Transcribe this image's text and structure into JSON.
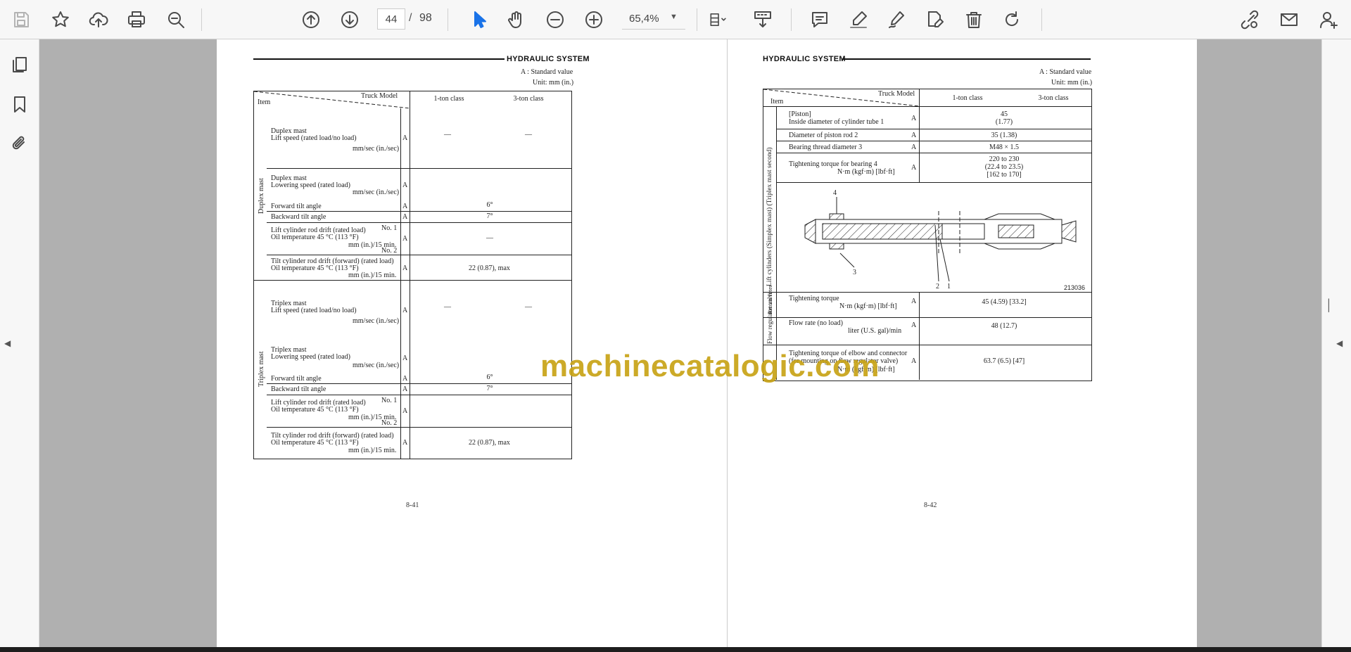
{
  "toolbar": {
    "page_current": "44",
    "page_separator": "/",
    "page_total": "98",
    "zoom": "65,4%",
    "icons": [
      "save-icon",
      "bookmark-star-icon",
      "upload-cloud-icon",
      "print-icon",
      "zoom-out-search-icon",
      "previous-page-icon",
      "next-page-icon",
      "select-arrow-icon",
      "hand-tool-icon",
      "zoom-out-icon",
      "zoom-in-icon",
      "page-view-icon",
      "scroll-mode-icon",
      "comment-icon",
      "highlight-pen-icon",
      "draw-pen-icon",
      "fill-sign-icon",
      "delete-icon",
      "rotate-icon",
      "share-link-icon",
      "email-icon",
      "add-user-icon"
    ]
  },
  "sidebar": {
    "icons": [
      "thumbnails-icon",
      "bookmarks-icon",
      "attachments-icon"
    ]
  },
  "watermark": "machinecatalogic.com",
  "left_page": {
    "header": "HYDRAULIC SYSTEM",
    "standard_note": "A : Standard value",
    "unit_note": "Unit: mm (in.)",
    "col_truck_model": "Truck Model",
    "col_item": "Item",
    "col_1ton": "1-ton class",
    "col_3ton": "3-ton class",
    "group_duplex": "Duplex mast",
    "group_triplex": "Triplex mast",
    "rows": {
      "dup_lift_1": "Duplex mast",
      "dup_lift_2": "Lift speed (rated load/no load)",
      "dup_lift_3": "mm/sec (in./sec)",
      "dup_lower_1": "Duplex mast",
      "dup_lower_2": "Lowering speed (rated load)",
      "dup_lower_3": "mm/sec (in./sec)",
      "dup_fwd": "Forward tilt angle",
      "dup_fwd_val": "6°",
      "dup_bwd": "Backward tilt angle",
      "dup_bwd_val": "7°",
      "dup_drift_1": "Lift cylinder rod drift (rated load)",
      "dup_drift_no1": "No. 1",
      "dup_drift_2": "Oil temperature 45 °C (113 °F)",
      "dup_drift_3": "mm (in.)/15 min.",
      "dup_drift_no2": "No. 2",
      "dup_drift_val": "—",
      "dup_tilt_1": "Tilt cylinder rod drift (forward) (rated load)",
      "dup_tilt_2": "Oil temperature 45 °C (113 °F)",
      "dup_tilt_3": "mm (in.)/15 min.",
      "dup_tilt_val": "22 (0.87), max",
      "dash": "—",
      "A": "A",
      "tri_lift_1": "Triplex mast",
      "tri_lift_2": "Lift speed (rated load/no load)",
      "tri_lift_3": "mm/sec (in./sec)",
      "tri_lower_1": "Triplex mast",
      "tri_lower_2": "Lowering speed (rated load)",
      "tri_lower_3": "mm/sec (in./sec)",
      "tri_fwd": "Forward tilt angle",
      "tri_fwd_val": "6°",
      "tri_bwd": "Backward tilt angle",
      "tri_bwd_val": "7°",
      "tri_drift_1": "Lift cylinder rod drift (rated load)",
      "tri_drift_no1": "No. 1",
      "tri_drift_2": "Oil temperature 45 °C (113 °F)",
      "tri_drift_3": "mm (in.)/15 min.",
      "tri_drift_no2": "No. 2",
      "tri_tilt_1": "Tilt cylinder rod drift (forward) (rated load)",
      "tri_tilt_2": "Oil temperature 45 °C (113 °F)",
      "tri_tilt_3": "mm (in.)/15 min.",
      "tri_tilt_val": "22 (0.87), max"
    },
    "page_number": "8-41"
  },
  "right_page": {
    "header": "HYDRAULIC SYSTEM",
    "standard_note": "A : Standard value",
    "unit_note": "Unit: mm (in.)",
    "col_truck_model": "Truck Model",
    "col_item": "Item",
    "col_1ton": "1-ton class",
    "col_3ton": "3-ton class",
    "group_lift_cyl": "Lift cylinders (Simplex mast) (Triplex mast second)",
    "group_return": "Return filter",
    "group_flow": "Flow regulator valve",
    "rows": {
      "piston_1": "[Piston]",
      "piston_2": "Inside diameter of cylinder tube 1",
      "piston_val_1": "45",
      "piston_val_2": "(1.77)",
      "rod": "Diameter of piston rod 2",
      "rod_val": "35 (1.38)",
      "thread": "Bearing thread diameter 3",
      "thread_val": "M48 × 1.5",
      "torque_1": "Tightening torque for bearing 4",
      "torque_2": "N·m (kgf·m) [lbf·ft]",
      "torque_val_1": "220 to 230",
      "torque_val_2": "(22.4 to 23.5)",
      "torque_val_3": "[162 to 170]",
      "fig_label_4": "4",
      "fig_label_3": "3",
      "fig_label_2": "2",
      "fig_label_1": "1",
      "fig_id": "213036",
      "ret_torque_1": "Tightening torque",
      "ret_torque_2": "N·m (kgf·m) [lbf·ft]",
      "ret_torque_val": "45 (4.59) [33.2]",
      "flow_1": "Flow rate (no load)",
      "flow_2": "liter (U.S. gal)/min",
      "flow_val": "48 (12.7)",
      "elbow_1": "Tightening torque of elbow and connector",
      "elbow_2": "(for mounting on flow regulator valve)",
      "elbow_3": "N·m (kgf·m) [lbf·ft]",
      "elbow_val": "63.7 (6.5) [47]",
      "A": "A"
    },
    "page_number": "8-42"
  }
}
